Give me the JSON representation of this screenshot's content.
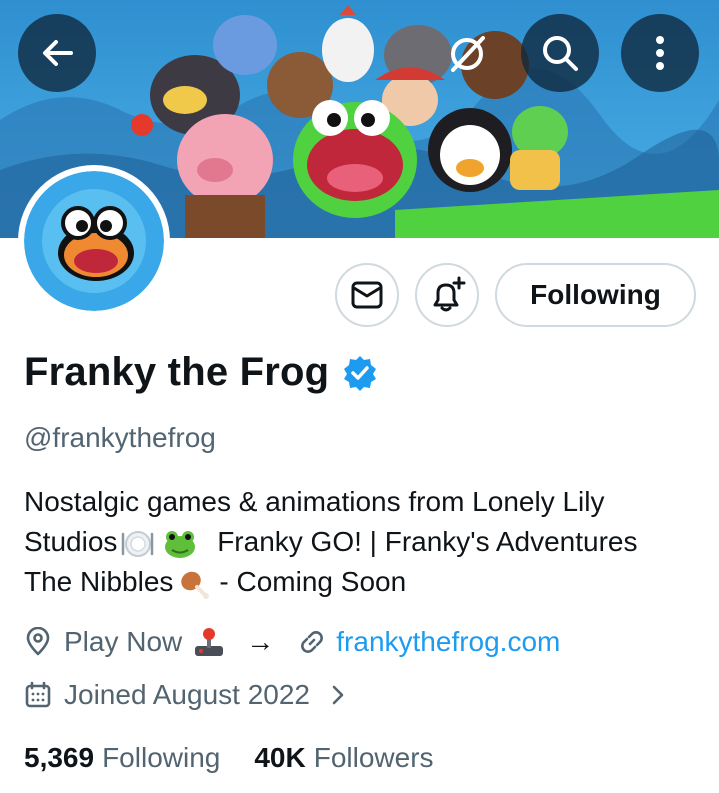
{
  "profile": {
    "display_name": "Franky the Frog",
    "handle": "@frankythefrog",
    "bio": {
      "line1": "Nostalgic games & animations from Lonely Lily",
      "line2_a": "Studios",
      "line2_b": "Franky GO! | Franky's Adventures",
      "line3_a": "The Nibbles",
      "line3_b": "- Coming Soon"
    },
    "location": "Play Now",
    "arrow": "→",
    "website": "frankythefrog.com",
    "joined": "Joined August 2022",
    "stats": {
      "following_count": "5,369",
      "following_label": "Following",
      "followers_count": "40K",
      "followers_label": "Followers"
    }
  },
  "actions": {
    "following_label": "Following"
  },
  "icons": {
    "back": "back-arrow-icon",
    "grok": "grok-icon",
    "search": "search-icon",
    "more": "more-vertical-icon",
    "message": "envelope-icon",
    "notify": "bell-plus-icon",
    "verified": "verified-badge-icon",
    "location": "location-pin-icon",
    "link": "link-icon",
    "calendar": "calendar-icon",
    "chevron": "chevron-right-icon"
  },
  "colors": {
    "accent": "#1d9bf0",
    "text": "#0f1419",
    "secondary": "#536471",
    "border": "#cfd9de"
  }
}
